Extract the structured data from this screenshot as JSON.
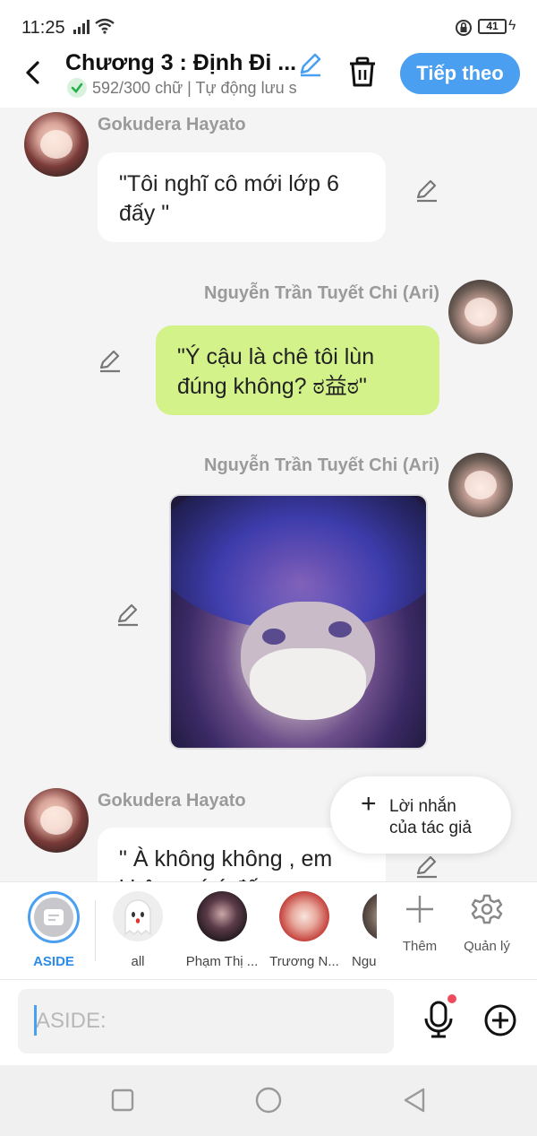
{
  "status_bar": {
    "time": "11:25",
    "battery_level": "41"
  },
  "header": {
    "chapter_title": "Chương 3 : Định Đi ...",
    "save_status": "592/300 chữ | Tự động lưu s",
    "next_button_label": "Tiếp theo",
    "accent_color": "#4a9ff1"
  },
  "messages": [
    {
      "sender": "Gokudera Hayato",
      "side": "left",
      "text": "\"Tôi nghĩ cô mới lớp 6\nđấy \""
    },
    {
      "sender": "Nguyễn Trần Tuyết Chi (Ari)",
      "side": "right",
      "text": "\"Ý cậu là chê tôi lùn\nđúng không? ಠ益ಠ\""
    },
    {
      "sender": "Nguyễn Trần Tuyết Chi (Ari)",
      "side": "right",
      "type": "image"
    },
    {
      "sender": "Gokudera Hayato",
      "side": "left",
      "text": "\" À không không , em\nkhông có ý đấy"
    }
  ],
  "author_note": {
    "label": "Lời nhắn\ncủa tác giả"
  },
  "character_bar": {
    "items": [
      {
        "label": "ASIDE",
        "selected": true
      },
      {
        "label": "all"
      },
      {
        "label": "Phạm Thị ..."
      },
      {
        "label": "Trương N..."
      },
      {
        "label": "Ngu"
      }
    ],
    "add_label": "Thêm",
    "manage_label": "Quản lý"
  },
  "composer": {
    "placeholder": "ASIDE:",
    "value": ""
  },
  "colors": {
    "bubble_own": "#d4f28a",
    "bubble_other": "#ffffff",
    "mic_notification": "#f04b5c"
  }
}
